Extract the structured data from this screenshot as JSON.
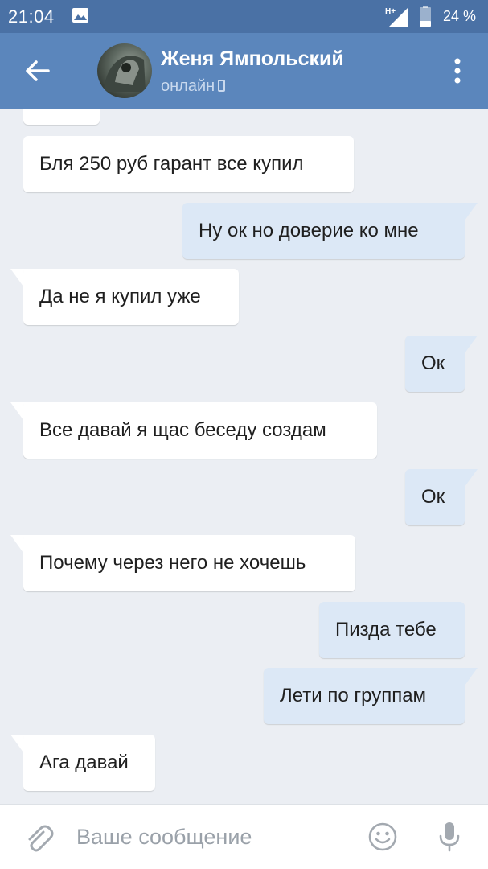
{
  "status_bar": {
    "time": "21:04",
    "network": "H+",
    "battery": "24 %"
  },
  "header": {
    "contact_name": "Женя Ямпольский",
    "contact_status": "онлайн",
    "colors": {
      "header_bg": "#5b86bc",
      "status_bar_bg": "#4a71a5"
    }
  },
  "messages": [
    {
      "side": "in",
      "text": ""
    },
    {
      "side": "in",
      "text": "Бля 250 руб гарант все купил"
    },
    {
      "side": "out",
      "text": "Ну ок но доверие ко мне"
    },
    {
      "side": "in",
      "text": "Да не я купил уже"
    },
    {
      "side": "out",
      "text": "Ок"
    },
    {
      "side": "in",
      "text": "Все давай я щас беседу создам"
    },
    {
      "side": "out",
      "text": "Ок"
    },
    {
      "side": "in",
      "text": "Почему через него не хочешь"
    },
    {
      "side": "out",
      "text": "Пизда тебе"
    },
    {
      "side": "out",
      "text": "Лети по группам"
    },
    {
      "side": "in",
      "text": "Ага давай"
    }
  ],
  "input_bar": {
    "placeholder": "Ваше сообщение",
    "value": ""
  },
  "icons": {
    "status_image": "image-icon",
    "signal": "signal-icon",
    "battery": "battery-icon",
    "back": "arrow-left-icon",
    "more": "more-vertical-icon",
    "phone": "phone-icon",
    "attach": "paperclip-icon",
    "emoji": "smiley-icon",
    "mic": "microphone-icon"
  },
  "colors": {
    "chat_bg": "#ebeef3",
    "incoming_bubble": "#ffffff",
    "outgoing_bubble": "#dce8f6"
  }
}
